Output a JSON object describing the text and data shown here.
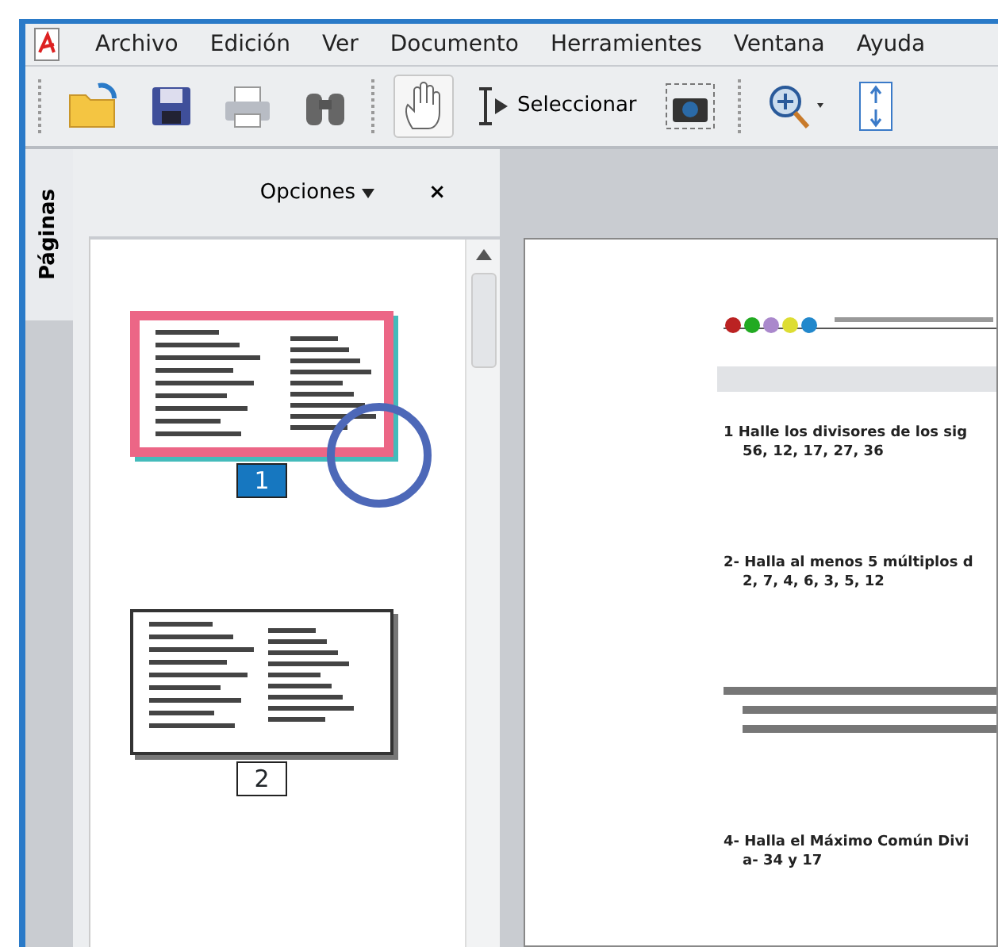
{
  "menu": [
    "Archivo",
    "Edición",
    "Ver",
    "Documento",
    "Herramientes",
    "Ventana",
    "Ayuda"
  ],
  "toolbar": {
    "select_label": "Seleccionar",
    "hand_selected": true
  },
  "side_panel": {
    "tab": "Páginas",
    "options": "Opciones",
    "close": "×",
    "thumbnails": [
      {
        "label": "1",
        "selected": true
      },
      {
        "label": "2",
        "selected": false
      }
    ]
  },
  "document": {
    "questions": [
      {
        "kind": "text",
        "lines": [
          "1  Halle los divisores de los sig",
          "56, 12, 17, 27, 36"
        ]
      },
      {
        "kind": "text",
        "lines": [
          "2- Halla al menos 5 múltiplos d",
          "2, 7, 4, 6, 3, 5, 12"
        ]
      },
      {
        "kind": "illegible"
      },
      {
        "kind": "text",
        "lines": [
          "4- Halla el Máximo Común Divi",
          "a- 34 y 17"
        ]
      }
    ]
  }
}
